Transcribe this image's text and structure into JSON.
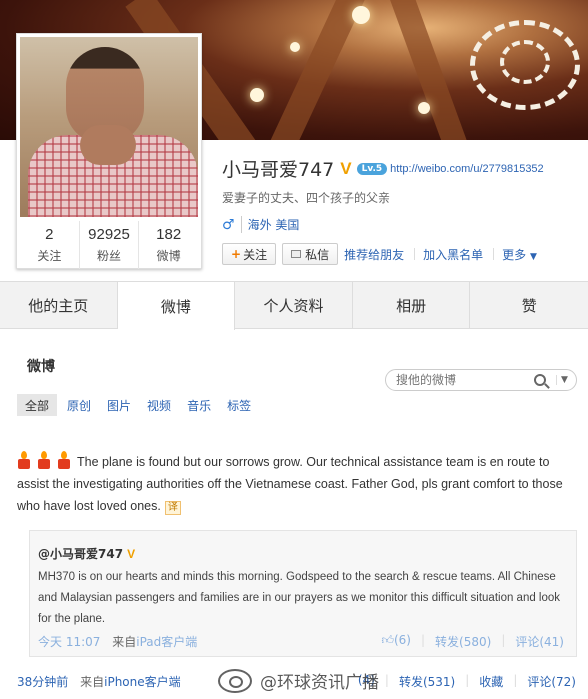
{
  "profile": {
    "name": "小马哥爱747",
    "v_badge": "V",
    "level_badge": "Lv.5",
    "url": "http://weibo.com/u/2779815352",
    "bio": "爱妻子的丈夫、四个孩子的父亲",
    "gender_icon": "male-icon",
    "gender_symbol": "♂",
    "location": "海外 美国"
  },
  "stats": [
    {
      "value": "2",
      "label": "关注"
    },
    {
      "value": "92925",
      "label": "粉丝"
    },
    {
      "value": "182",
      "label": "微博"
    }
  ],
  "actions": {
    "follow": "关注",
    "message": "私信",
    "recommend": "推荐给朋友",
    "blacklist": "加入黑名单",
    "more": "更多"
  },
  "tabs": [
    "他的主页",
    "微博",
    "个人资料",
    "相册",
    "赞"
  ],
  "active_tab": "微博",
  "feed": {
    "title": "微博",
    "search_placeholder": "搜他的微博",
    "filters": [
      "全部",
      "原创",
      "图片",
      "视频",
      "音乐",
      "标签"
    ]
  },
  "post": {
    "text": "The plane is found but our sorrows grow. Our technical assistance team is en route to assist the investigating authorities off the Vietnamese coast. Father God, pls grant comfort to those who have lost loved ones.",
    "translate_label": "译",
    "repost": {
      "author": "@小马哥爱747",
      "v_badge": "V",
      "text": "MH370 is on our hearts and minds this morning. Godspeed to the search & rescue teams. All Chinese and Malaysian passengers and families are in our prayers as we monitor this difficult situation and look for the plane.",
      "time": "今天 11:07",
      "source_prefix": "来自",
      "source": "iPad客户端",
      "likes": "(6)",
      "reposts": "转发(580)",
      "comments": "评论(41)"
    },
    "time": "38分钟前",
    "source_prefix": "来自",
    "source": "iPhone客户端",
    "likes": "(4)",
    "reposts": "转发(531)",
    "favorite": "收藏",
    "comments": "评论(72)"
  },
  "watermark": "@环球资讯广播",
  "colors": {
    "link": "#2d64b3",
    "v_badge": "#f0a000",
    "tab_bg": "#f2f2f2"
  }
}
